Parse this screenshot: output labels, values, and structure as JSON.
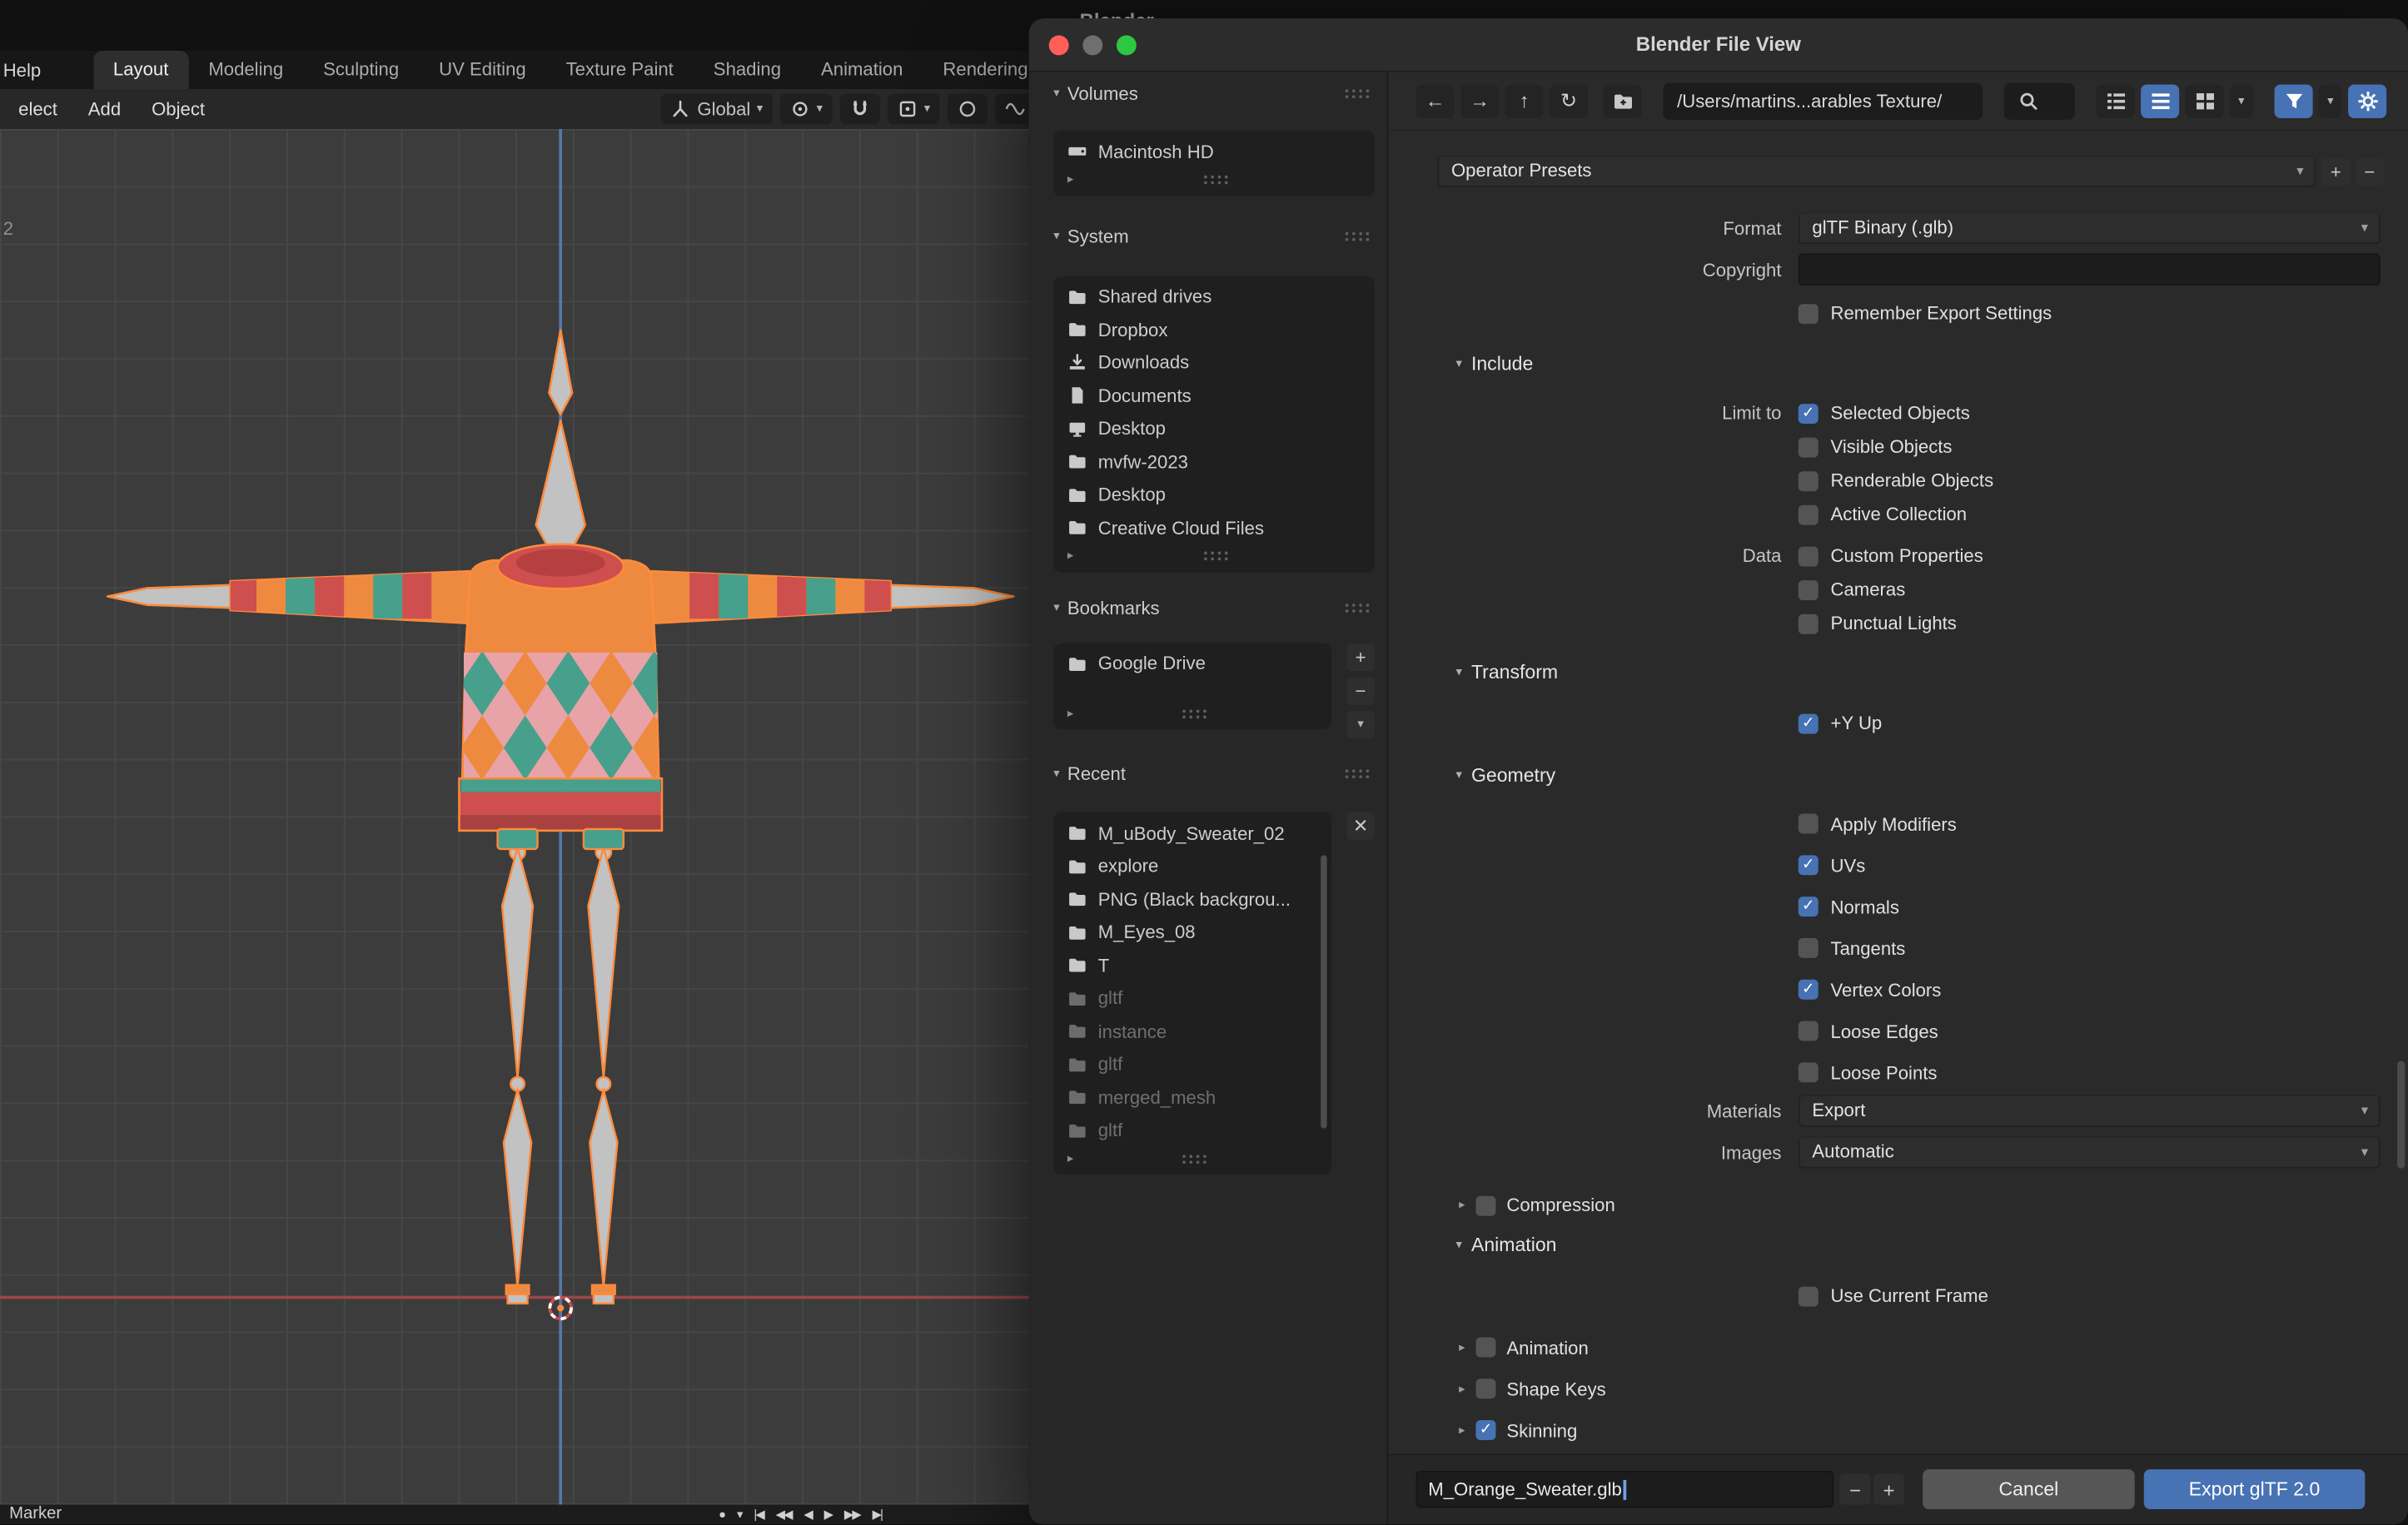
{
  "ui": {
    "plus": "+",
    "minus": "−",
    "close": "✕"
  },
  "colors": {
    "accent": "#4772b3",
    "light_close": "#ff5f57",
    "light_minimize": "#6f6f6f",
    "light_zoom": "#2bc840",
    "sweater_orange": "#ee8a3f",
    "sweater_red": "#cf4f4f",
    "sweater_teal": "#46a08b",
    "argyle_pink": "#e7a3a8",
    "mannequin_gray": "#c2c2c2",
    "selection_orange": "#ff8a3c"
  },
  "background": {
    "app_title": "Blender",
    "menu_help": "Help",
    "workspace_tabs": [
      "Layout",
      "Modeling",
      "Sculpting",
      "UV Editing",
      "Texture Paint",
      "Shading",
      "Animation",
      "Rendering"
    ],
    "active_tab": "Layout",
    "viewport_menus": [
      "elect",
      "Add",
      "Object"
    ],
    "orientation_dropdown": "Global",
    "stray_label": "2",
    "timeline_label": "Marker",
    "playback": [
      {
        "name": "auto-keying",
        "glyph": "●"
      },
      {
        "name": "auto-keying-menu",
        "glyph": "▾"
      },
      {
        "name": "jump-to-start",
        "glyph": "|◀"
      },
      {
        "name": "prev-keyframe",
        "glyph": "◀◀"
      },
      {
        "name": "play-reverse",
        "glyph": "◀"
      },
      {
        "name": "play",
        "glyph": "▶"
      },
      {
        "name": "next-keyframe",
        "glyph": "▶▶"
      },
      {
        "name": "jump-to-end",
        "glyph": "▶|"
      }
    ]
  },
  "dialog": {
    "title": "Blender File View",
    "toolbar": {
      "path": "/Users/martins...arables Texture/"
    },
    "sidebar": {
      "volumes": {
        "title": "Volumes",
        "items": [
          {
            "label": "Macintosh HD",
            "icon": "drive"
          }
        ]
      },
      "system": {
        "title": "System",
        "items": [
          {
            "label": "Shared drives",
            "icon": "folder"
          },
          {
            "label": "Dropbox",
            "icon": "folder"
          },
          {
            "label": "Downloads",
            "icon": "download"
          },
          {
            "label": "Documents",
            "icon": "document"
          },
          {
            "label": "Desktop",
            "icon": "desktop"
          },
          {
            "label": "mvfw-2023",
            "icon": "folder"
          },
          {
            "label": "Desktop",
            "icon": "folder"
          },
          {
            "label": "Creative Cloud Files",
            "icon": "folder"
          }
        ]
      },
      "bookmarks": {
        "title": "Bookmarks",
        "items": [
          {
            "label": "Google Drive",
            "icon": "folder"
          }
        ]
      },
      "recent": {
        "title": "Recent",
        "items": [
          {
            "label": "M_uBody_Sweater_02",
            "icon": "folder"
          },
          {
            "label": "explore",
            "icon": "folder"
          },
          {
            "label": "PNG (Black backgrou...",
            "icon": "folder"
          },
          {
            "label": "M_Eyes_08",
            "icon": "folder"
          },
          {
            "label": "T",
            "icon": "folder"
          },
          {
            "label": "gltf",
            "icon": "folder",
            "dimmed": true
          },
          {
            "label": "instance",
            "icon": "folder",
            "dimmed": true
          },
          {
            "label": "gltf",
            "icon": "folder",
            "dimmed": true
          },
          {
            "label": "merged_mesh",
            "icon": "folder",
            "dimmed": true
          },
          {
            "label": "gltf",
            "icon": "folder",
            "dimmed": true
          }
        ]
      }
    },
    "export_settings": {
      "presets_label": "Operator Presets",
      "format": {
        "label": "Format",
        "value": "glTF Binary (.glb)"
      },
      "copyright_label": "Copyright",
      "copyright_value": "",
      "remember_items": [
        {
          "label": "Remember Export Settings",
          "checked": false
        }
      ],
      "include": {
        "title": "Include",
        "limit_label": "Limit to",
        "limit_items": [
          {
            "label": "Selected Objects",
            "checked": true
          },
          {
            "label": "Visible Objects",
            "checked": false
          },
          {
            "label": "Renderable Objects",
            "checked": false
          },
          {
            "label": "Active Collection",
            "checked": false
          }
        ],
        "data_label": "Data",
        "data_items": [
          {
            "label": "Custom Properties",
            "checked": false
          },
          {
            "label": "Cameras",
            "checked": false
          },
          {
            "label": "Punctual Lights",
            "checked": false
          }
        ]
      },
      "transform": {
        "title": "Transform",
        "items": [
          {
            "label": "+Y Up",
            "checked": true
          }
        ]
      },
      "geometry": {
        "title": "Geometry",
        "items": [
          {
            "label": "Apply Modifiers",
            "checked": false
          },
          {
            "label": "UVs",
            "checked": true
          },
          {
            "label": "Normals",
            "checked": true
          },
          {
            "label": "Tangents",
            "checked": false
          },
          {
            "label": "Vertex Colors",
            "checked": true
          },
          {
            "label": "Loose Edges",
            "checked": false
          },
          {
            "label": "Loose Points",
            "checked": false
          }
        ],
        "materials_label": "Materials",
        "materials_value": "Export",
        "images_label": "Images",
        "images_value": "Automatic"
      },
      "compression_items": [
        {
          "label": "Compression",
          "checked": false
        }
      ],
      "animation": {
        "title": "Animation",
        "frame_items": [
          {
            "label": "Use Current Frame",
            "checked": false
          }
        ],
        "sub_items": [
          {
            "label": "Animation",
            "checked": false
          },
          {
            "label": "Shape Keys",
            "checked": false
          },
          {
            "label": "Skinning",
            "checked": true
          }
        ]
      }
    },
    "footer": {
      "filename": "M_Orange_Sweater.glb",
      "cancel_label": "Cancel",
      "export_label": "Export glTF 2.0"
    }
  }
}
